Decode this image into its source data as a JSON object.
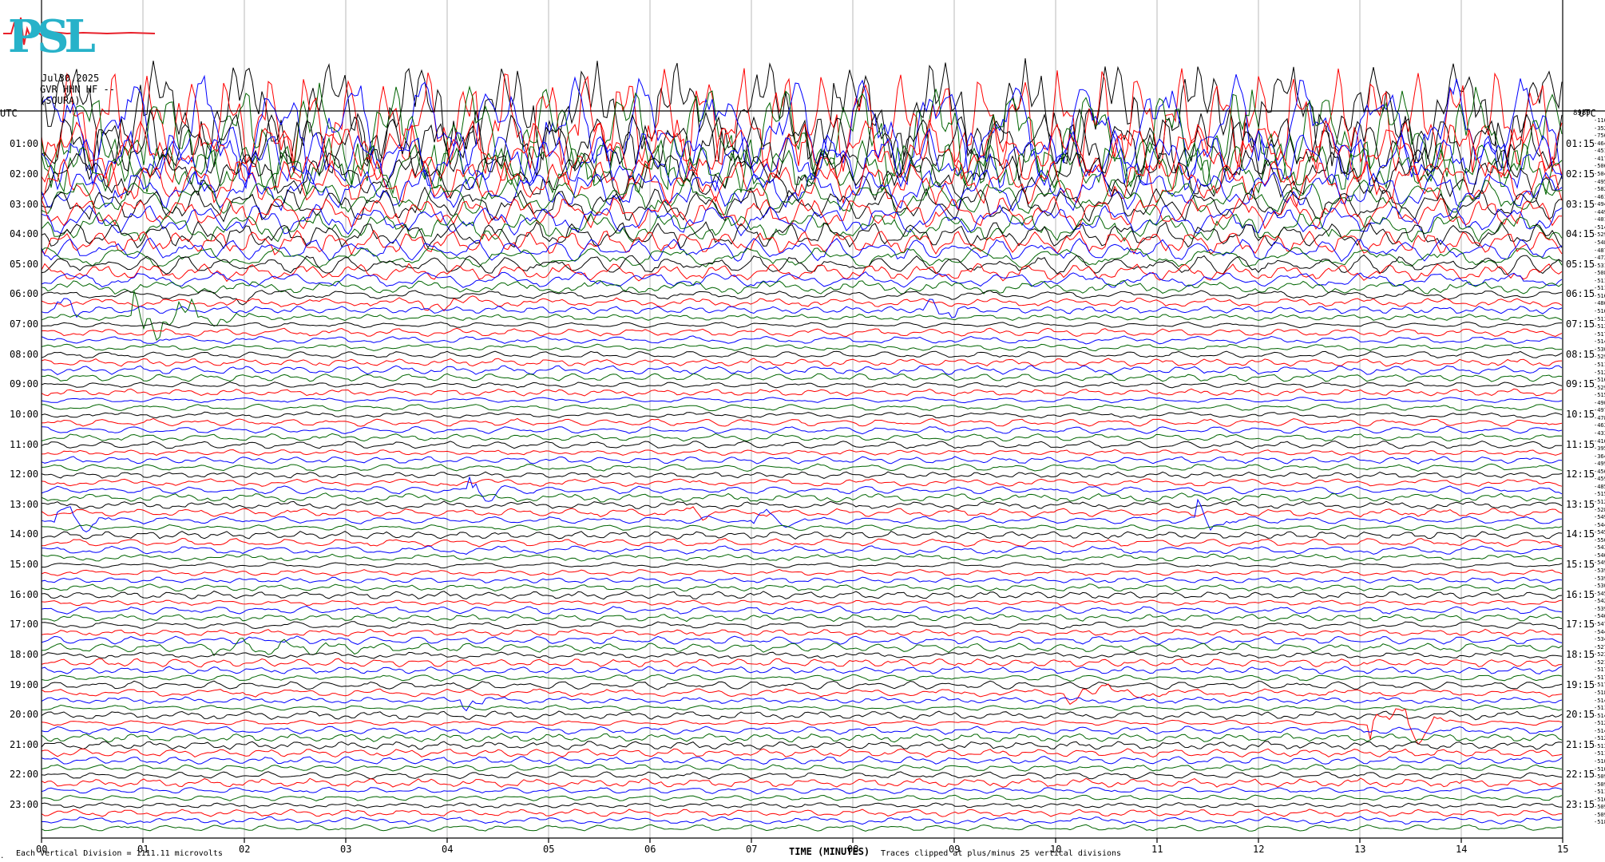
{
  "logo_text": "PSL",
  "header": {
    "date": "Jul30,2025",
    "station": "GVR HHN HF --",
    "source": "(SOURA)"
  },
  "left_axis_label": "UTC",
  "right_axis_label": "UTC",
  "right_axis_top_value": "8989",
  "footer": {
    "scale_note": "Each Vertical Division = 1111.11 microvolts",
    "x_axis_title": "TIME (MINUTES)",
    "clip_note": "Traces clipped at plus/minus 25 vertical divisions"
  },
  "chart_data": {
    "type": "line",
    "title": "",
    "xlabel": "TIME (MINUTES)",
    "ylabel": "UTC",
    "xlim": [
      0,
      15
    ],
    "x_ticks": [
      "00",
      "01",
      "02",
      "03",
      "04",
      "05",
      "06",
      "07",
      "08",
      "09",
      "10",
      "11",
      "12",
      "13",
      "14",
      "15"
    ],
    "left_hour_labels": [
      "01:00",
      "02:00",
      "03:00",
      "04:00",
      "05:00",
      "06:00",
      "07:00",
      "08:00",
      "09:00",
      "10:00",
      "11:00",
      "12:00",
      "13:00",
      "14:00",
      "15:00",
      "16:00",
      "17:00",
      "18:00",
      "19:00",
      "20:00",
      "21:00",
      "22:00",
      "23:00"
    ],
    "right_hour_labels": [
      "01:15",
      "02:15",
      "03:15",
      "04:15",
      "05:15",
      "06:15",
      "07:15",
      "08:15",
      "09:15",
      "10:15",
      "11:15",
      "12:15",
      "13:15",
      "14:15",
      "15:15",
      "16:15",
      "17:15",
      "18:15",
      "19:15",
      "20:15",
      "21:15",
      "22:15",
      "23:15"
    ],
    "trace_count": 96,
    "trace_minutes": 15,
    "series_colors": [
      "#000000",
      "#ff0000",
      "#0000ff",
      "#006400"
    ],
    "trace_offsets": [
      "-11672",
      "-3529",
      "-7568",
      "-4642",
      "-4517",
      "-4175",
      "-5066",
      "-5048",
      "-4957",
      "-5820",
      "-4619",
      "-4940",
      "-4499",
      "-4019",
      "-5144",
      "-5295",
      "-5489",
      "-4877",
      "-4731",
      "-5318",
      "-5087",
      "-5114",
      "-5117",
      "-5167",
      "-4861",
      "-5169",
      "-5139",
      "-5138",
      "-5179",
      "-5146",
      "-5309",
      "-5291",
      "-5113",
      "-5127",
      "-5166",
      "-5298",
      "-5151",
      "-4902",
      "-4971",
      "-4784",
      "-4632",
      "-4332",
      "-4167",
      "-3952",
      "-3644",
      "-4995",
      "-4564",
      "-4599",
      "-4856",
      "-5153",
      "-5126",
      "-5288",
      "-5497",
      "-5444",
      "-5455",
      "-5568",
      "-5437",
      "-5467",
      "-5499",
      "-5395",
      "-5394",
      "-5309",
      "-5459",
      "-5427",
      "-5396",
      "-5463",
      "-5471",
      "-5448",
      "-5347",
      "-5279",
      "-5237",
      "-5219",
      "-5175",
      "-5171",
      "-5176",
      "-5187",
      "-5142",
      "-5118",
      "-5145",
      "-5125",
      "-5145",
      "-5126",
      "-5131",
      "-5115",
      "-5108",
      "-5105",
      "-5094",
      "-5094",
      "-5118",
      "-5163",
      "-5092",
      "-5091",
      "-5185"
    ],
    "events": [
      {
        "trace": 24,
        "start_min": 1.7,
        "end_min": 2.5,
        "amp": 0.55
      },
      {
        "trace": 25,
        "start_min": 3.7,
        "end_min": 4.6,
        "amp": 0.5
      },
      {
        "trace": 26,
        "start_min": 0.15,
        "end_min": 0.45,
        "amp": 1.2
      },
      {
        "trace": 27,
        "start_min": 0.9,
        "end_min": 2.1,
        "amp": 2.0
      },
      {
        "trace": 26,
        "start_min": 8.7,
        "end_min": 9.2,
        "amp": 0.8
      },
      {
        "trace": 50,
        "start_min": 4.2,
        "end_min": 4.6,
        "amp": 1.6
      },
      {
        "trace": 54,
        "start_min": 0.1,
        "end_min": 0.8,
        "amp": 1.1
      },
      {
        "trace": 54,
        "start_min": 7.0,
        "end_min": 7.6,
        "amp": 0.7
      },
      {
        "trace": 54,
        "start_min": 11.4,
        "end_min": 11.9,
        "amp": 1.2
      },
      {
        "trace": 53,
        "start_min": 6.3,
        "end_min": 6.6,
        "amp": 1.0
      },
      {
        "trace": 81,
        "start_min": 13.1,
        "end_min": 14.0,
        "amp": 2.6
      },
      {
        "trace": 77,
        "start_min": 10.1,
        "end_min": 11.2,
        "amp": 0.5
      },
      {
        "trace": 71,
        "start_min": 1.7,
        "end_min": 3.5,
        "amp": 0.45
      },
      {
        "trace": 78,
        "start_min": 4.1,
        "end_min": 4.5,
        "amp": 0.6
      }
    ]
  }
}
